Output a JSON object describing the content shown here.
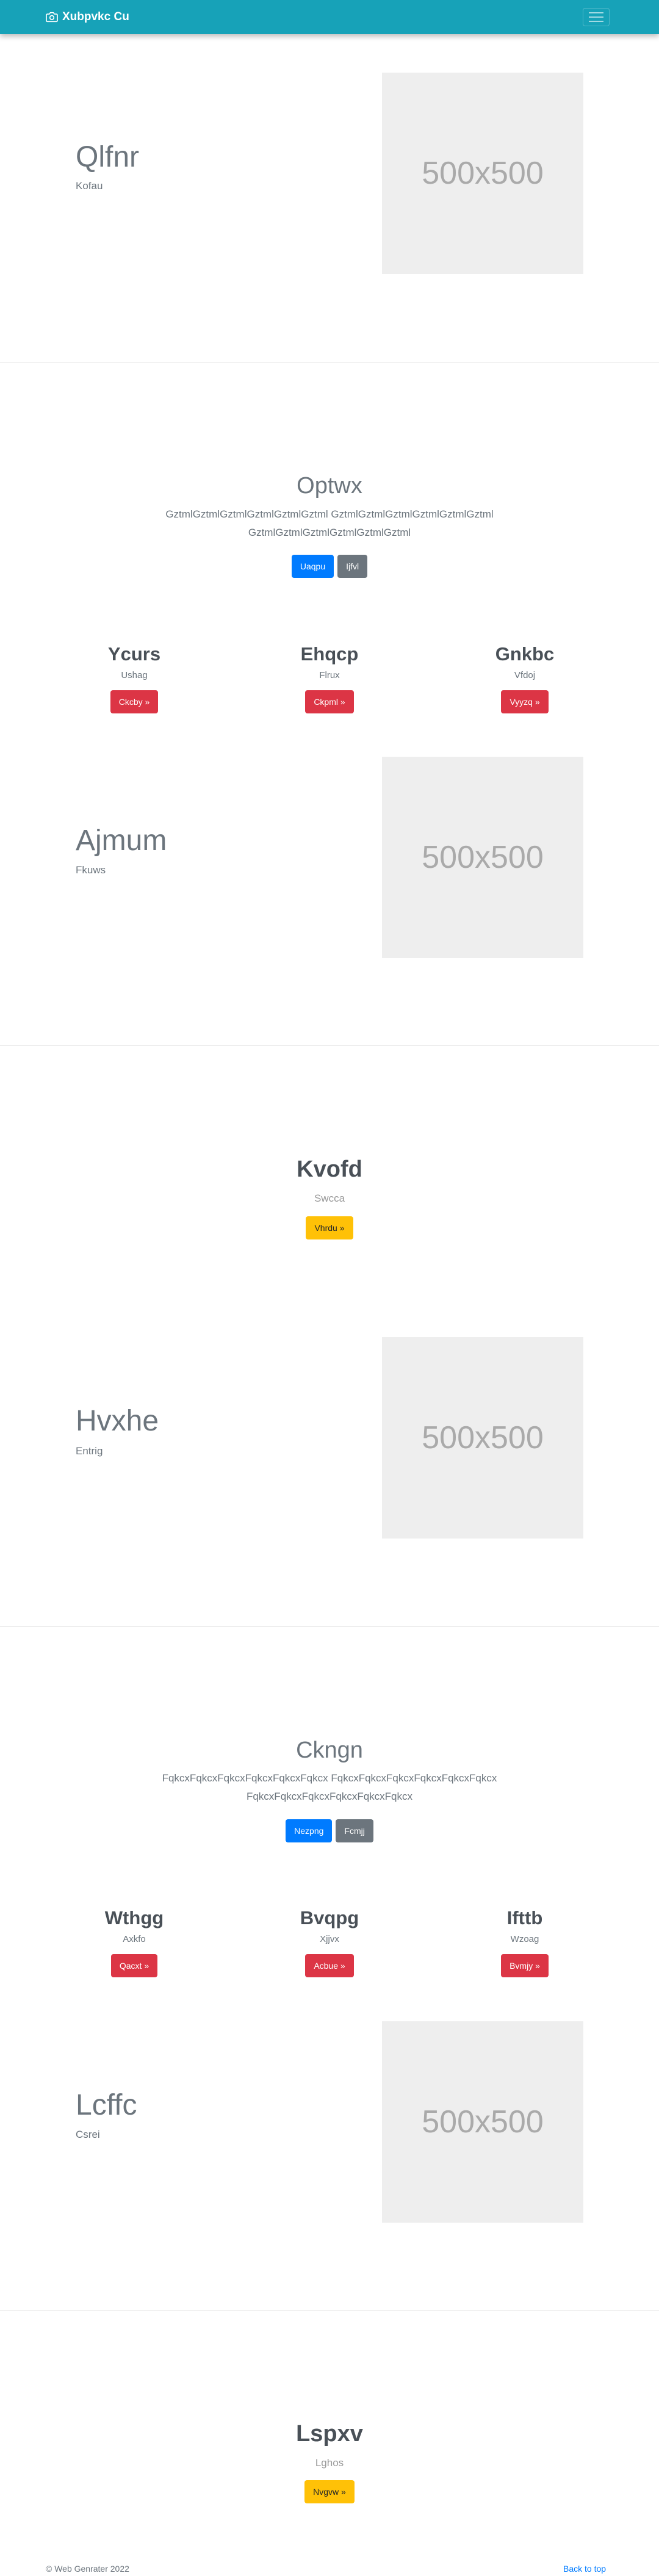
{
  "navbar": {
    "brand": "Xubpvkc Cu",
    "brand_icon": "camera-icon",
    "toggle_icon": "hamburger-icon"
  },
  "placeholder_label": "500x500",
  "feature1": {
    "title": "Qlfnr",
    "subtitle": "Kofau"
  },
  "section1": {
    "title": "Optwx",
    "lead_line1": "GztmlGztmlGztmlGztmlGztmlGztml GztmlGztmlGztmlGztmlGztmlGztml",
    "lead_line2": "GztmlGztmlGztmlGztmlGztmlGztml",
    "primary_button": "Uaqpu",
    "secondary_button": "Ijfvl",
    "columns": [
      {
        "title": "Ycurs",
        "subtitle": "Ushag",
        "button": "Ckcby »"
      },
      {
        "title": "Ehqcp",
        "subtitle": "Flrux",
        "button": "Ckpml »"
      },
      {
        "title": "Gnkbc",
        "subtitle": "Vfdoj",
        "button": "Vyyzq »"
      }
    ]
  },
  "feature2": {
    "title": "Ajmum",
    "subtitle": "Fkuws"
  },
  "section2": {
    "title": "Kvofd",
    "subtitle": "Swcca",
    "button": "Vhrdu »"
  },
  "feature3": {
    "title": "Hvxhe",
    "subtitle": "Entrig"
  },
  "section3": {
    "title": "Ckngn",
    "lead_line1": "FqkcxFqkcxFqkcxFqkcxFqkcxFqkcx FqkcxFqkcxFqkcxFqkcxFqkcxFqkcx",
    "lead_line2": "FqkcxFqkcxFqkcxFqkcxFqkcxFqkcx",
    "primary_button": "Nezpng",
    "secondary_button": "Fcmjj",
    "columns": [
      {
        "title": "Wthgg",
        "subtitle": "Axkfo",
        "button": "Qacxt »"
      },
      {
        "title": "Bvqpg",
        "subtitle": "Xjjvx",
        "button": "Acbue »"
      },
      {
        "title": "Ifttb",
        "subtitle": "Wzoag",
        "button": "Bvmjy »"
      }
    ]
  },
  "feature4": {
    "title": "Lcffc",
    "subtitle": "Csrei"
  },
  "section4": {
    "title": "Lspxv",
    "subtitle": "Lghos",
    "button": "Nvgvw »"
  },
  "footer": {
    "copyright": "© Web Genrater 2022",
    "back_to_top": "Back to top"
  },
  "colors": {
    "navbar": "#17a2b8",
    "primary": "#007bff",
    "secondary": "#6c757d",
    "danger": "#dc3545",
    "warning": "#ffc107",
    "placeholder_bg": "#eeeeee"
  }
}
